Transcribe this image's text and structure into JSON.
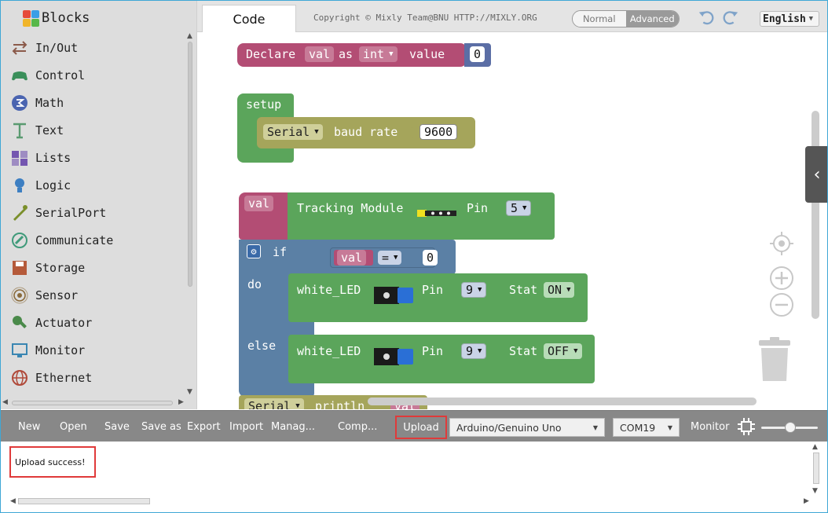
{
  "sidebar": {
    "title": "Blocks",
    "categories": [
      {
        "label": "In/Out",
        "icon": "in-out-icon",
        "color": "#8b5a4a"
      },
      {
        "label": "Control",
        "icon": "gamepad-icon",
        "color": "#3a8f5a"
      },
      {
        "label": "Math",
        "icon": "math-icon",
        "color": "#4a64b0"
      },
      {
        "label": "Text",
        "icon": "text-t-icon",
        "color": "#5a9a70"
      },
      {
        "label": "Lists",
        "icon": "lists-icon",
        "color": "#7456b0"
      },
      {
        "label": "Logic",
        "icon": "logic-bulb-icon",
        "color": "#3d7fc2"
      },
      {
        "label": "SerialPort",
        "icon": "serialport-pen-icon",
        "color": "#7a8f2a"
      },
      {
        "label": "Communicate",
        "icon": "communicate-icon",
        "color": "#3f9a7a"
      },
      {
        "label": "Storage",
        "icon": "storage-icon",
        "color": "#b55a3a"
      },
      {
        "label": "Sensor",
        "icon": "sensor-icon",
        "color": "#8a6a3a"
      },
      {
        "label": "Actuator",
        "icon": "actuator-icon",
        "color": "#4a8a4a"
      },
      {
        "label": "Monitor",
        "icon": "monitor-icon",
        "color": "#3a86b2"
      },
      {
        "label": "Ethernet",
        "icon": "ethernet-globe-icon",
        "color": "#b04a3a"
      }
    ]
  },
  "topbar": {
    "tab_code": "Code",
    "copyright": "Copyright © Mixly Team@BNU HTTP://MIXLY.ORG",
    "mode_normal": "Normal",
    "mode_advanced": "Advanced",
    "language": "English"
  },
  "workspace": {
    "declare": {
      "kw_declare": "Declare",
      "var": "val",
      "kw_as": "as",
      "type": "int",
      "kw_value": "value",
      "init": "0"
    },
    "setup": {
      "label": "setup",
      "serial": "Serial",
      "kw_baud": "baud rate",
      "baud": "9600"
    },
    "assign": {
      "var": "val",
      "module": "Tracking Module",
      "kw_pin": "Pin",
      "pin": "5"
    },
    "if_block": {
      "kw_if": "if",
      "var": "val",
      "op": "=",
      "rhs": "0",
      "kw_do": "do",
      "kw_else": "else"
    },
    "led_do": {
      "name": "white_LED",
      "kw_pin": "Pin",
      "pin": "9",
      "kw_stat": "Stat",
      "stat": "ON"
    },
    "led_else": {
      "name": "white_LED",
      "kw_pin": "Pin",
      "pin": "9",
      "kw_stat": "Stat",
      "stat": "OFF"
    },
    "println": {
      "serial": "Serial",
      "kw": "println",
      "var": "val"
    }
  },
  "toolbar": {
    "new": "New",
    "open": "Open",
    "save": "Save",
    "save_as": "Save as",
    "export": "Export",
    "import": "Import",
    "manage": "Manag...",
    "compile": "Comp...",
    "upload": "Upload",
    "board": "Arduino/Genuino Uno",
    "port": "COM19",
    "monitor": "Monitor"
  },
  "output": {
    "message": "Upload success!"
  },
  "colors": {
    "accent_red": "#e03a3a",
    "toolbar": "#888888",
    "sidebar": "#dddddd",
    "var_block": "#b34d74",
    "logic_block": "#5b80a5",
    "setup_block": "#5ba55b",
    "serial_block": "#a5a55b"
  }
}
